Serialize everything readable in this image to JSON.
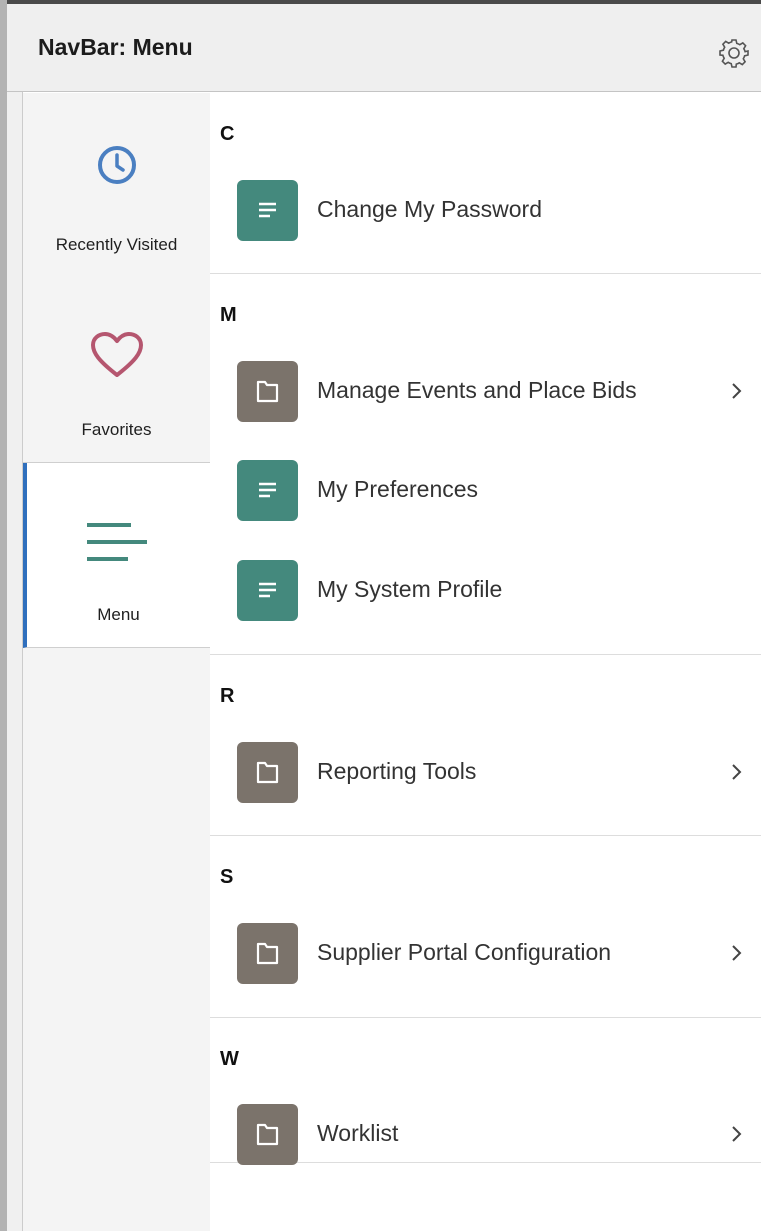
{
  "header": {
    "title": "NavBar: Menu",
    "settings_icon": "gear-icon"
  },
  "sidebar": {
    "items": [
      {
        "label": "Recently Visited",
        "icon": "clock-icon",
        "color": "#4a7fc1",
        "selected": false
      },
      {
        "label": "Favorites",
        "icon": "heart-icon",
        "color": "#b5566f",
        "selected": false
      },
      {
        "label": "Menu",
        "icon": "menu-lines-icon",
        "color": "#44897d",
        "selected": true
      }
    ],
    "selected_accent": "#2f6fbd"
  },
  "menu": {
    "sections": [
      {
        "letter": "C",
        "items": [
          {
            "label": "Change My Password",
            "type": "component",
            "icon": "page-icon",
            "has_children": false
          }
        ]
      },
      {
        "letter": "M",
        "items": [
          {
            "label": "Manage Events and Place Bids",
            "type": "folder",
            "icon": "folder-icon",
            "has_children": true
          },
          {
            "label": "My Preferences",
            "type": "component",
            "icon": "page-icon",
            "has_children": false
          },
          {
            "label": "My System Profile",
            "type": "component",
            "icon": "page-icon",
            "has_children": false
          }
        ]
      },
      {
        "letter": "R",
        "items": [
          {
            "label": "Reporting Tools",
            "type": "folder",
            "icon": "folder-icon",
            "has_children": true
          }
        ]
      },
      {
        "letter": "S",
        "items": [
          {
            "label": "Supplier Portal Configuration",
            "type": "folder",
            "icon": "folder-icon",
            "has_children": true
          }
        ]
      },
      {
        "letter": "W",
        "items": [
          {
            "label": "Worklist",
            "type": "folder",
            "icon": "folder-icon",
            "has_children": true
          }
        ]
      }
    ]
  },
  "colors": {
    "component_tile": "#44897d",
    "folder_tile": "#7b736b"
  }
}
